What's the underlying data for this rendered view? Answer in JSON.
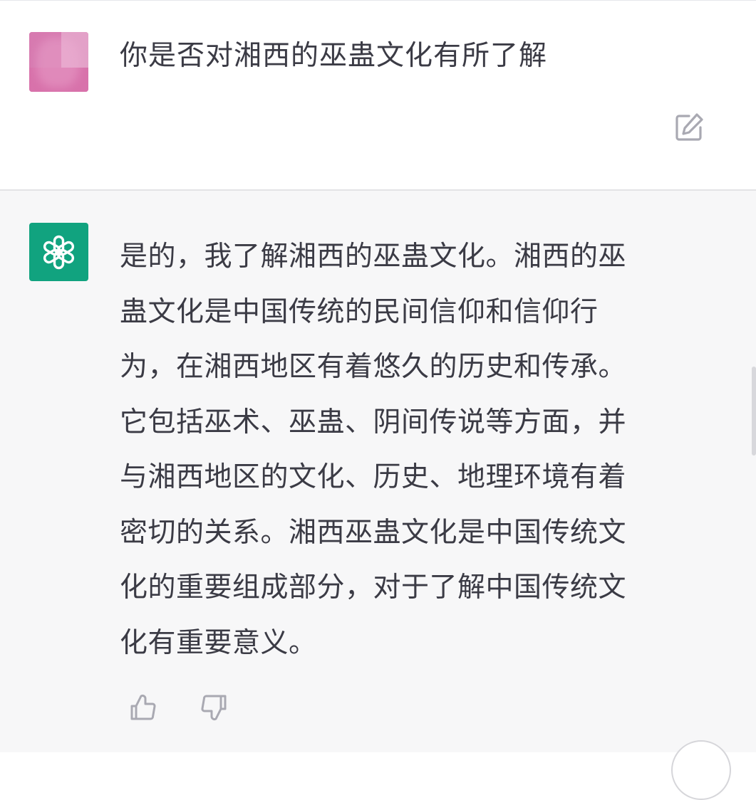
{
  "conversation": {
    "user_message": "你是否对湘西的巫蛊文化有所了解",
    "assistant_lines": [
      "是的，我了解湘西的巫蛊文化。湘西的巫",
      "蛊文化是中国传统的民间信仰和信仰行",
      "为，在湘西地区有着悠久的历史和传承。",
      "它包括巫术、巫蛊、阴间传说等方面，并",
      "与湘西地区的文化、历史、地理环境有着",
      "密切的关系。湘西巫蛊文化是中国传统文",
      "化的重要组成部分，对于了解中国传统文",
      "化有重要意义。"
    ]
  },
  "icons": {
    "edit": "edit-icon",
    "bot_logo": "openai-logo-icon",
    "like": "thumbs-up-icon",
    "dislike": "thumbs-down-icon"
  },
  "colors": {
    "assistant_bg": "#f7f7f8",
    "bot_avatar": "#11a37f",
    "user_avatar": "#de8bbd"
  }
}
